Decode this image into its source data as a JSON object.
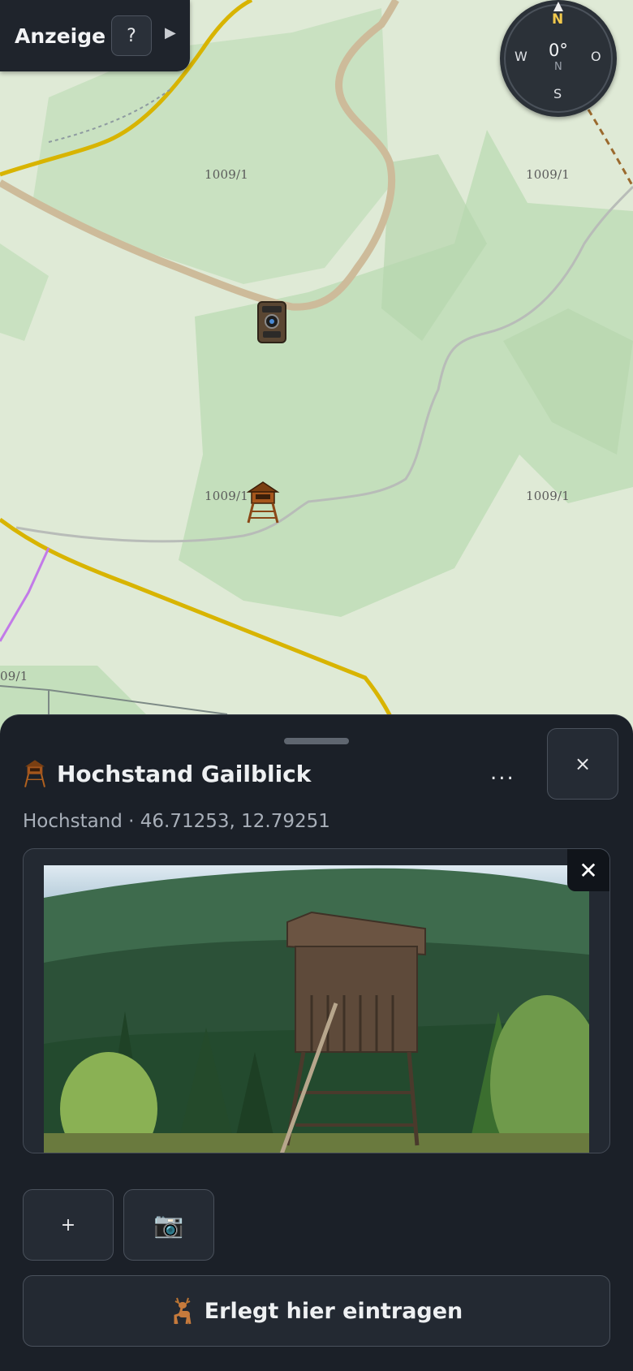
{
  "controls": {
    "display_label": "Anzeige",
    "help_label": "?",
    "expand_label": "▶"
  },
  "compass": {
    "north": "N",
    "south": "S",
    "west": "W",
    "east": "O",
    "heading": "0°",
    "heading_dir": "N"
  },
  "map": {
    "parcels": [
      "1009/1",
      "1009/1",
      "1009/1",
      "1009/1",
      "09/1"
    ]
  },
  "sheet": {
    "title": "Hochstand Gailblick",
    "subtitle": "Hochstand · 46.71253, 12.79251",
    "more_label": "...",
    "close_label": "×",
    "photo_remove_label": "✕",
    "add_label": "+",
    "camera_label": "📷",
    "record_label": "Erlegt hier eintragen"
  }
}
